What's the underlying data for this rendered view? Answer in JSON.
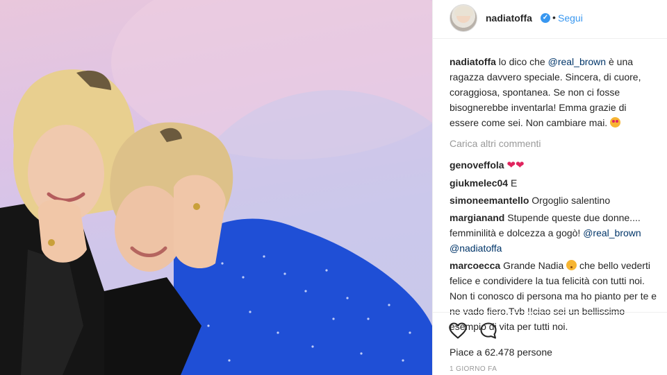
{
  "header": {
    "username": "nadiatoffa",
    "verified_symbol": "✓",
    "separator": "•",
    "follow_label": "Segui"
  },
  "caption": {
    "username": "nadiatoffa",
    "text_before_mention": "lo dico che ",
    "mention": "@real_brown",
    "text_after_mention": " è una ragazza davvero speciale. Sincera, di cuore, coraggiosa, spontanea. Se non ci fosse bisognerebbe inventarla! Emma grazie di essere come sei. Non cambiare mai. ",
    "emoji": "heart-eyes-emoji"
  },
  "load_more_label": "Carica altri commenti",
  "comments": [
    {
      "username": "genoveffola",
      "text": "",
      "hearts": "❤❤"
    },
    {
      "username": "giukmelec04",
      "text": "E"
    },
    {
      "username": "simoneemantello",
      "text": "Orgoglio salentino"
    },
    {
      "username": "margianand",
      "text_before": "Stupende queste due donne.... femminilità e dolcezza a gogò! ",
      "mention1": "@real_brown",
      "mention2": "@nadiatoffa"
    },
    {
      "username": "marcoecca",
      "text_before": "Grande Nadia ",
      "emoji": "kissing-face-emoji",
      "text_after": " che bello vederti felice e condividere la tua felicità con tutti noi. Non ti conosco di persona ma ho pianto per te e ne vado fiero.Tvb !!ciao sei un bellissimo esempio di vita per tutti noi."
    }
  ],
  "actions": {
    "like_icon": "heart-outline-icon",
    "comment_icon": "comment-bubble-icon",
    "likes_text": "Piace a 62.478 persone",
    "timestamp": "1 GIORNO FA"
  },
  "colors": {
    "link_blue": "#3897f0",
    "mention": "#003569",
    "muted": "#999999",
    "text": "#262626"
  }
}
